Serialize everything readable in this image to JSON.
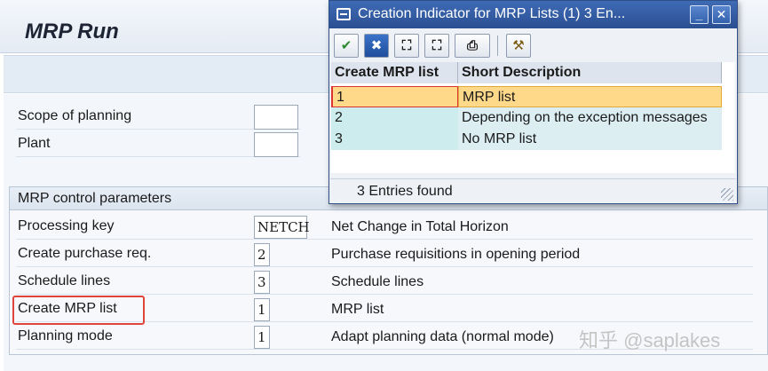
{
  "main": {
    "title": "MRP Run",
    "fields": [
      {
        "label": "Scope of planning",
        "value": ""
      },
      {
        "label": "Plant",
        "value": ""
      }
    ],
    "group": {
      "title": "MRP control parameters",
      "rows": [
        {
          "label": "Processing key",
          "value": "NETCH",
          "description": "Net Change in Total Horizon"
        },
        {
          "label": "Create purchase req.",
          "value": "2",
          "description": "Purchase requisitions in opening period"
        },
        {
          "label": "Schedule lines",
          "value": "3",
          "description": "Schedule lines"
        },
        {
          "label": "Create MRP list",
          "value": "1",
          "description": "MRP list"
        },
        {
          "label": "Planning mode",
          "value": "1",
          "description": "Adapt planning data (normal mode)"
        }
      ]
    }
  },
  "popup": {
    "title": "Creation Indicator for MRP Lists (1)    3 En...",
    "window_buttons": {
      "minimize": "_",
      "close": "✕"
    },
    "toolbar": [
      {
        "icon": "checkmark-icon",
        "glyph": "✔"
      },
      {
        "icon": "cancel-icon",
        "glyph": "✖"
      },
      {
        "icon": "binoculars-icon",
        "glyph": "⛶"
      },
      {
        "icon": "find-next-icon",
        "glyph": "⛶"
      },
      {
        "icon": "print-icon",
        "glyph": "⎙"
      },
      {
        "icon": "tools-icon",
        "glyph": "⚒"
      }
    ],
    "columns": [
      "Create MRP list",
      "Short Description"
    ],
    "rows": [
      {
        "key": "1",
        "description": "MRP list"
      },
      {
        "key": "2",
        "description": "Depending on the exception messages"
      },
      {
        "key": "3",
        "description": "No MRP list"
      }
    ],
    "status": "3 Entries found"
  },
  "watermark": "知乎 @saplakes",
  "colors": {
    "popup_title": "#2a4f92",
    "selected_row": "#ffd98a",
    "highlight": "#e0453d"
  }
}
